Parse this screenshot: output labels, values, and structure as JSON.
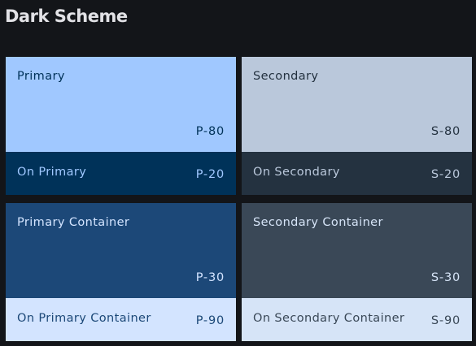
{
  "header": {
    "title": "Dark Scheme"
  },
  "tiles": {
    "primary": {
      "label": "Primary",
      "code": "P-80",
      "bg": "#a0c8ff",
      "fg": "#003259"
    },
    "on_primary": {
      "label": "On Primary",
      "code": "P-20",
      "bg": "#003259",
      "fg": "#a0c8ff"
    },
    "secondary": {
      "label": "Secondary",
      "code": "S-80",
      "bg": "#bac8db",
      "fg": "#243240"
    },
    "on_secondary": {
      "label": "On Secondary",
      "code": "S-20",
      "bg": "#243240",
      "fg": "#bac8db"
    },
    "primary_container": {
      "label": "Primary Container",
      "code": "P-30",
      "bg": "#1c4878",
      "fg": "#d3e4ff"
    },
    "on_primary_container": {
      "label": "On Primary Container",
      "code": "P-90",
      "bg": "#d3e4ff",
      "fg": "#1c4878"
    },
    "secondary_container": {
      "label": "Secondary Container",
      "code": "S-30",
      "bg": "#3a4857",
      "fg": "#d6e4f7"
    },
    "on_secondary_container": {
      "label": "On Secondary Container",
      "code": "S-90",
      "bg": "#d6e4f7",
      "fg": "#3a4857"
    }
  }
}
